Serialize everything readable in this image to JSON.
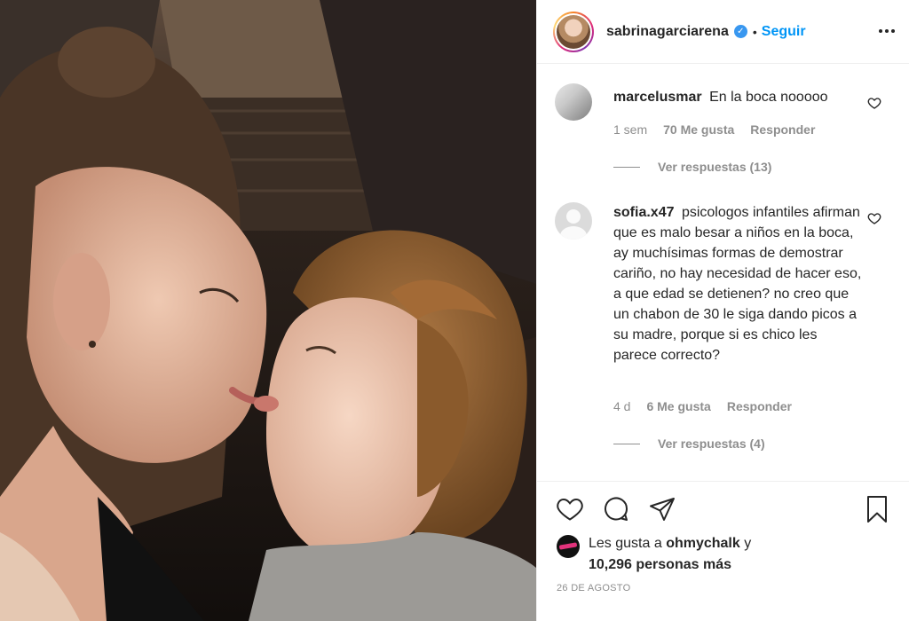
{
  "post": {
    "author": {
      "username": "sabrinagarciarena",
      "verified_symbol": "✓",
      "separator": "•",
      "follow_label": "Seguir"
    },
    "comments": [
      {
        "username": "marcelusmar",
        "text": "En la boca nooooo",
        "time": "1 sem",
        "likes": "70 Me gusta",
        "reply_label": "Responder",
        "replies_label": "Ver respuestas (13)"
      },
      {
        "username": "sofia.x47",
        "text": "psicologos infantiles afirman que es malo besar a niños en la boca, ay muchísimas formas de demostrar cariño, no hay necesidad de hacer eso, a que edad se detienen? no creo que un chabon de 30 le siga dando picos a su madre, porque si es chico les parece correcto?",
        "time": "4 d",
        "likes": "6 Me gusta",
        "reply_label": "Responder",
        "replies_label": "Ver respuestas (4)"
      }
    ],
    "likes_summary": {
      "prefix": "Les gusta a",
      "liker": "ohmychalk",
      "connector": "y",
      "count_text": "10,296 personas más"
    },
    "date": "26 DE AGOSTO",
    "icons": {
      "like": "heart-icon",
      "comment": "comment-icon",
      "share": "paper-plane-icon",
      "save": "bookmark-icon",
      "more": "more-options-icon"
    },
    "colors": {
      "link_blue": "#0095f6",
      "muted_text": "#8e8e8e",
      "border": "#efefef"
    }
  }
}
